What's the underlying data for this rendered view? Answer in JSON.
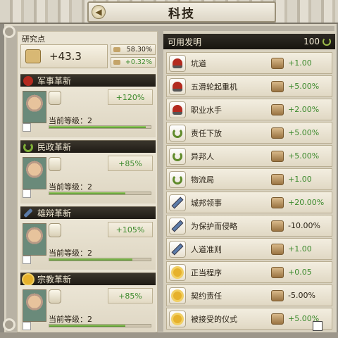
{
  "window": {
    "title": "科技",
    "back_icon": "back-arrow-icon"
  },
  "research": {
    "label": "研究点",
    "value": "+43.3",
    "stat1": "58.30%",
    "stat2": "+0.32%"
  },
  "categories": [
    {
      "label": "军事革新",
      "icon": "military-helmet-icon",
      "bonus": "+120%",
      "level_text": "当前等级：2",
      "progress": 0.95
    },
    {
      "label": "民政革新",
      "icon": "laurel-icon",
      "bonus": "+85%",
      "level_text": "当前等级：2",
      "progress": 0.75
    },
    {
      "label": "雄辩革新",
      "icon": "rhetoric-quill-icon",
      "bonus": "+105%",
      "level_text": "当前等级：2",
      "progress": 0.82
    },
    {
      "label": "宗教革新",
      "icon": "religion-sun-icon",
      "bonus": "+85%",
      "level_text": "当前等级：2",
      "progress": 0.75
    }
  ],
  "inventions": {
    "header": "可用发明",
    "count": "100",
    "rows": [
      {
        "type": "military",
        "label": "坑道",
        "value": "+1.00",
        "neg": false
      },
      {
        "type": "military",
        "label": "五滑轮起重机",
        "value": "+5.00%",
        "neg": false
      },
      {
        "type": "military",
        "label": "职业水手",
        "value": "+2.00%",
        "neg": false
      },
      {
        "type": "civic",
        "label": "责任下放",
        "value": "+5.00%",
        "neg": false
      },
      {
        "type": "civic",
        "label": "异邦人",
        "value": "+5.00%",
        "neg": false
      },
      {
        "type": "civic",
        "label": "物流局",
        "value": "+1.00",
        "neg": false
      },
      {
        "type": "rhetoric",
        "label": "城邦领事",
        "value": "+20.00%",
        "neg": false
      },
      {
        "type": "rhetoric",
        "label": "为保护而侵略",
        "value": "-10.00%",
        "neg": true
      },
      {
        "type": "rhetoric",
        "label": "人道准则",
        "value": "+1.00",
        "neg": false
      },
      {
        "type": "religion",
        "label": "正当程序",
        "value": "+0.05",
        "neg": false
      },
      {
        "type": "religion",
        "label": "契约责任",
        "value": "-5.00%",
        "neg": true
      },
      {
        "type": "religion",
        "label": "被接受的仪式",
        "value": "+5.00%",
        "neg": false
      }
    ]
  }
}
